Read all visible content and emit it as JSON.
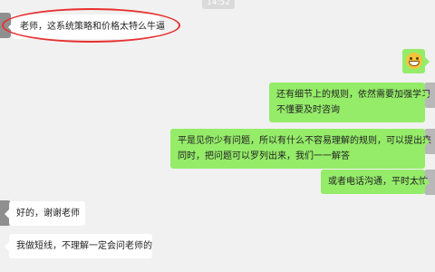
{
  "chat": {
    "time_label": "14:52",
    "messages": [
      {
        "side": "in",
        "lines": [
          "老师，这系统策略和价格太特么牛逼"
        ]
      },
      {
        "side": "out",
        "emoji": "grinning-face"
      },
      {
        "side": "out",
        "lines": [
          "还有细节上的规则，依然需要加强学习",
          "不懂要及时咨询"
        ]
      },
      {
        "side": "out",
        "lines": [
          "平是见你少有问题，所以有什么不容易理解的规则，可以提出来",
          "同时，把问题可以罗列出来，我们一一解答"
        ]
      },
      {
        "side": "out",
        "lines": [
          "或者电话沟通，平时太忙"
        ]
      },
      {
        "side": "in",
        "lines": [
          "好的，谢谢老师"
        ]
      },
      {
        "side": "in",
        "lines": [
          "我做短线，不理解一定会问老师的"
        ]
      }
    ]
  },
  "colors": {
    "background": "#f1f1f1",
    "incoming_bubble": "#ffffff",
    "outgoing_bubble": "#95ec69",
    "annotation_ring": "#e8302f"
  }
}
